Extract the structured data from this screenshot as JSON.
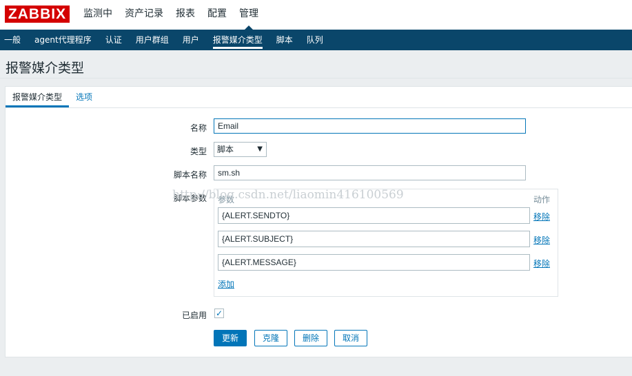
{
  "header": {
    "logo_text": "ZABBIX",
    "menu": [
      "监测中",
      "资产记录",
      "报表",
      "配置",
      "管理"
    ]
  },
  "subnav": [
    "一般",
    "agent代理程序",
    "认证",
    "用户群组",
    "用户",
    "报警媒介类型",
    "脚本",
    "队列"
  ],
  "page_title": "报警媒介类型",
  "tabs": [
    "报警媒介类型",
    "选项"
  ],
  "form": {
    "name_label": "名称",
    "name_value": "Email",
    "type_label": "类型",
    "type_value": "脚本",
    "script_name_label": "脚本名称",
    "script_name_value": "sm.sh",
    "script_params_label": "脚本参数",
    "params_header": "参数",
    "action_header": "动作",
    "params": [
      "{ALERT.SENDTO}",
      "{ALERT.SUBJECT}",
      "{ALERT.MESSAGE}"
    ],
    "remove_label": "移除",
    "add_label": "添加",
    "enabled_label": "已启用",
    "enabled": true
  },
  "buttons": {
    "update": "更新",
    "clone": "克隆",
    "delete": "删除",
    "cancel": "取消"
  },
  "watermark": "http://blog.csdn.net/liaomin416100569",
  "colors": {
    "brand_red": "#d40000",
    "nav_blue": "#0a466a",
    "link_blue": "#0275b8"
  }
}
